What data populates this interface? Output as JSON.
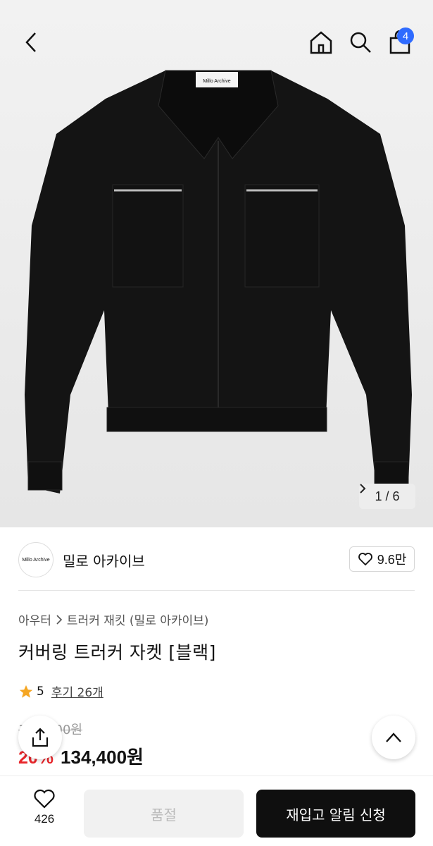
{
  "header": {
    "back_icon": "chevron-left-icon",
    "home_icon": "home-icon",
    "search_icon": "search-icon",
    "cart_icon": "shopping-bag-icon",
    "cart_count": "4"
  },
  "gallery": {
    "page_current": "1",
    "page_separator": "/",
    "page_total": "6",
    "next_icon": "chevron-right-icon",
    "logo_label": "Millo Archive"
  },
  "brand": {
    "logo_text": "Millo Archive",
    "name": "밀로 아카이브",
    "likes": "9.6만"
  },
  "breadcrumb": {
    "category": "아우터",
    "subcategory": "트러커 재킷 (밀로 아카이브)"
  },
  "product": {
    "title": "커버링 트러커 자켓 [블랙]",
    "rating": "5",
    "reviews": "후기 26개",
    "original_price": "168,000원",
    "discount": "20%",
    "price": "134,400원"
  },
  "bottom": {
    "wish_count": "426",
    "soldout_label": "품절",
    "restock_label": "재입고 알림 신청"
  },
  "colors": {
    "badge": "#2f6bff",
    "discount": "#e8262b",
    "primary_button": "#0f0f0f",
    "star": "#f5a623"
  }
}
